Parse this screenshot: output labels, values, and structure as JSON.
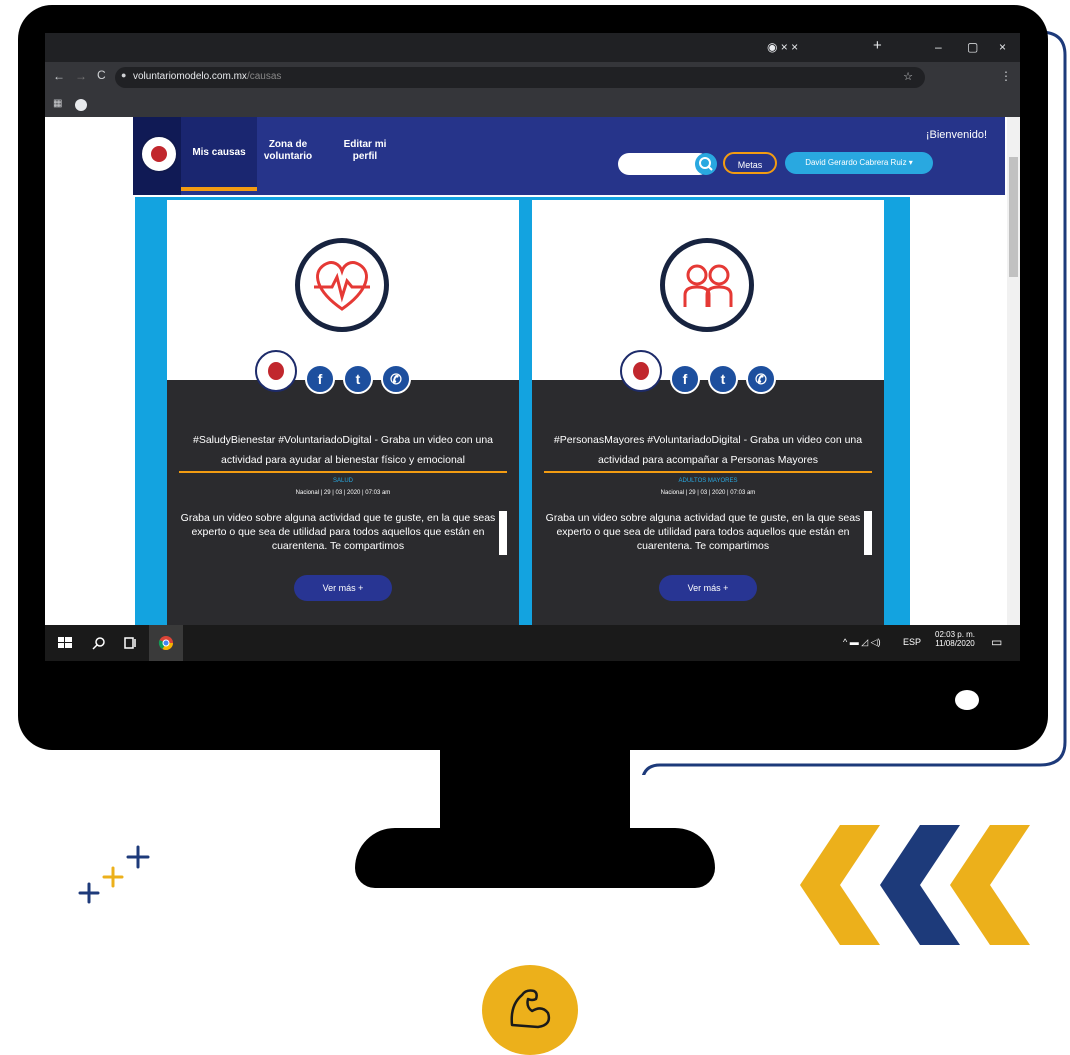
{
  "browser": {
    "tab_text": "◉ × ×",
    "new_tab": "+",
    "window_controls": [
      "–",
      "▢",
      "×"
    ],
    "url_domain": "voluntariomodelo.com.mx",
    "url_path": "/causas"
  },
  "navbar": {
    "items": [
      {
        "label": "Mis causas"
      },
      {
        "label": "Zona de voluntario"
      },
      {
        "label": "Editar mi perfil"
      }
    ],
    "welcome": "¡Bienvenido!",
    "metas_label": "Metas",
    "user_label": "David Gerardo Cabrera Ruiz ▾"
  },
  "cards": [
    {
      "title": "#SaludyBienestar #VoluntariadoDigital - Graba un video con una actividad para ayudar al bienestar físico y emocional",
      "category": "SALUD",
      "date": "Nacional  |  29  |  03  |  2020  |  07:03 am",
      "description": "Graba un video sobre alguna actividad que te guste, en la que seas experto o que sea de utilidad para todos aquellos que están en cuarentena. Te compartimos",
      "button": "Ver más +"
    },
    {
      "title": "#PersonasMayores #VoluntariadoDigital - Graba un video con una actividad para acompañar a Personas Mayores",
      "category": "ADULTOS MAYORES",
      "date": "Nacional  |  29  |  03  |  2020  |  07:03 am",
      "description": "Graba un video sobre alguna actividad que te guste, en la que seas experto o que sea de utilidad para todos aquellos que están en cuarentena. Te compartimos",
      "button": "Ver más +"
    }
  ],
  "taskbar": {
    "lang": "ESP",
    "time": "02:03 p. m.",
    "date": "11/08/2020"
  },
  "colors": {
    "nav_blue": "#26348a",
    "content_blue": "#13a3e0",
    "accent_orange": "#f39c12",
    "chevron_yellow": "#ecb01b",
    "chevron_navy": "#1d3a7a"
  }
}
